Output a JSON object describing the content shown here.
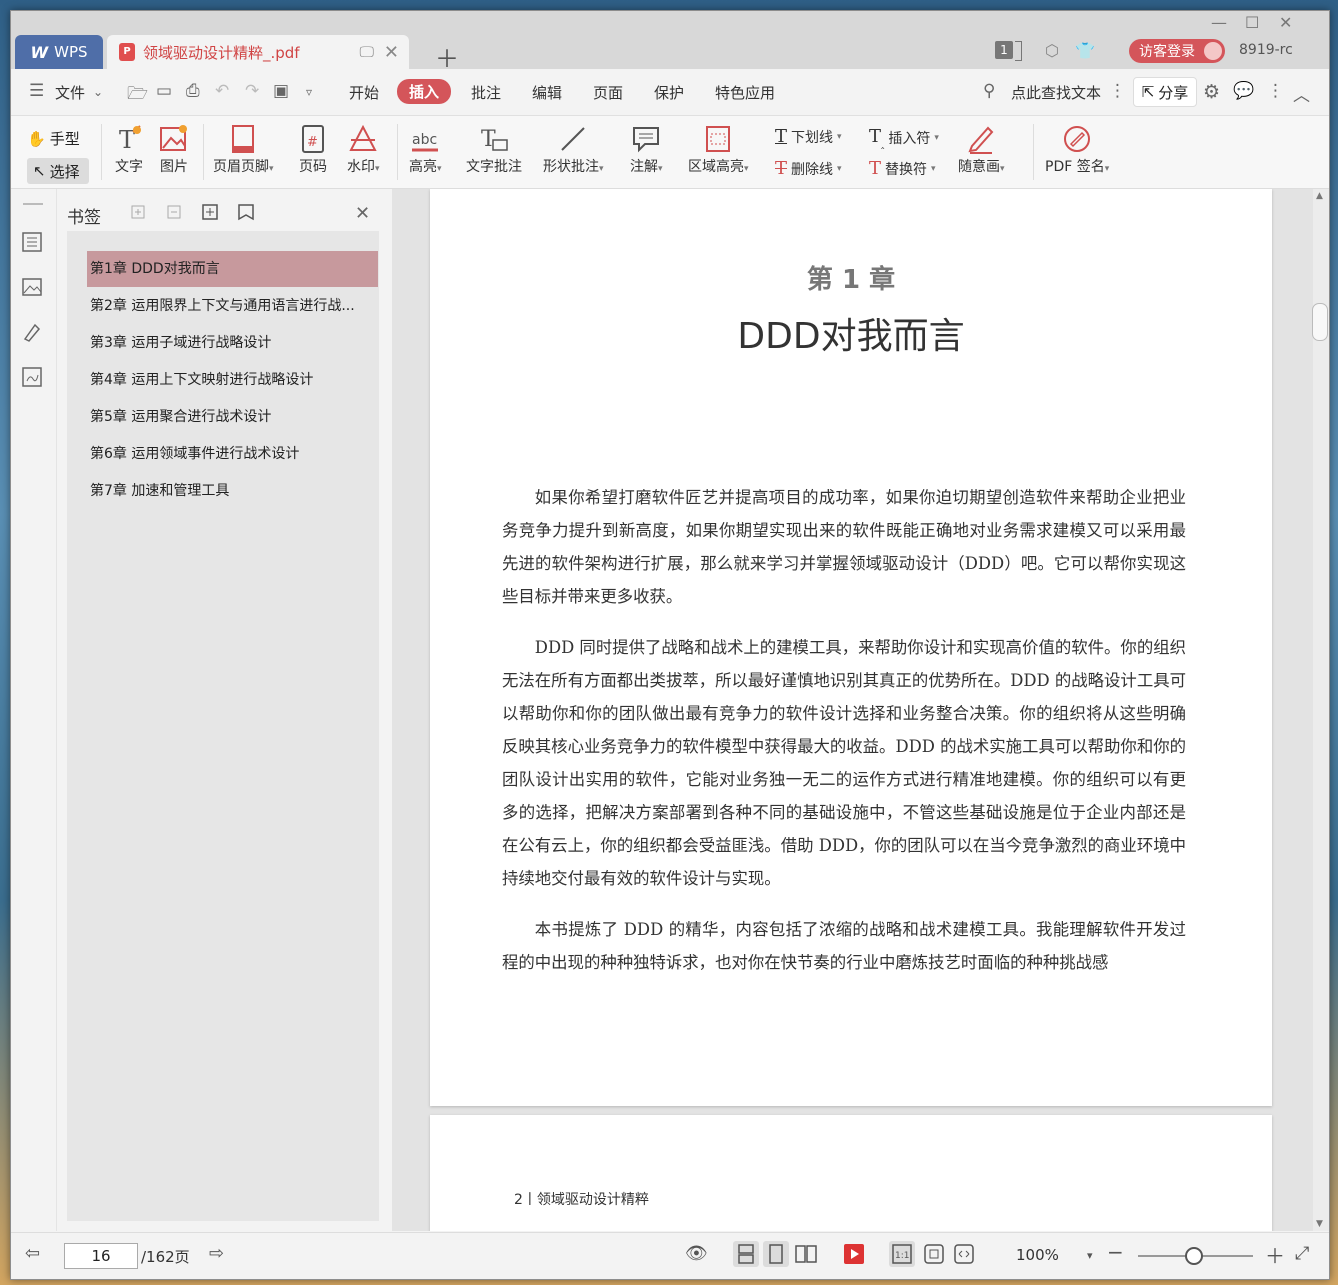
{
  "titlebar": {
    "app_tab": "WPS",
    "doc_tab": "领域驱动设计精粹_.pdf",
    "page_badge": "1",
    "login_label": "访客登录",
    "user_id": "8919-rc"
  },
  "menu": {
    "file_label": "文件",
    "tabs": [
      "开始",
      "插入",
      "批注",
      "编辑",
      "页面",
      "保护",
      "特色应用"
    ],
    "active_tab": "插入",
    "search_text": "点此查找文本",
    "share_label": "分享"
  },
  "ribbon": {
    "hand_label": "手型",
    "select_label": "选择",
    "text_label": "文字",
    "image_label": "图片",
    "header_footer_label": "页眉页脚",
    "page_num_label": "页码",
    "watermark_label": "水印",
    "highlight_label": "高亮",
    "text_note_label": "文字批注",
    "shape_note_label": "形状批注",
    "annotation_label": "注解",
    "area_highlight_label": "区域高亮",
    "underline_label": "下划线",
    "strikeout_label": "删除线",
    "insert_mark_label": "插入符",
    "replace_mark_label": "替换符",
    "freehand_label": "随意画",
    "pdf_sign_label": "PDF 签名"
  },
  "bookmarks": {
    "title": "书签",
    "items": [
      "第1章 DDD对我而言",
      "第2章 运用限界上下文与通用语言进行战...",
      "第3章 运用子域进行战略设计",
      "第4章 运用上下文映射进行战略设计",
      "第5章 运用聚合进行战术设计",
      "第6章 运用领域事件进行战术设计",
      "第7章 加速和管理工具"
    ],
    "selected_index": 0
  },
  "document": {
    "chapter_number": "第 1 章",
    "chapter_title": "DDD对我而言",
    "paragraphs": [
      "如果你希望打磨软件匠艺并提高项目的成功率，如果你迫切期望创造软件来帮助企业把业务竞争力提升到新高度，如果你期望实现出来的软件既能正确地对业务需求建模又可以采用最先进的软件架构进行扩展，那么就来学习并掌握领域驱动设计（DDD）吧。它可以帮你实现这些目标并带来更多收获。",
      "DDD 同时提供了战略和战术上的建模工具，来帮助你设计和实现高价值的软件。你的组织无法在所有方面都出类拔萃，所以最好谨慎地识别其真正的优势所在。DDD 的战略设计工具可以帮助你和你的团队做出最有竞争力的软件设计选择和业务整合决策。你的组织将从这些明确反映其核心业务竞争力的软件模型中获得最大的收益。DDD 的战术实施工具可以帮助你和你的团队设计出实用的软件，它能对业务独一无二的运作方式进行精准地建模。你的组织可以有更多的选择，把解决方案部署到各种不同的基础设施中，不管这些基础设施是位于企业内部还是在公有云上，你的组织都会受益匪浅。借助 DDD，你的团队可以在当今竞争激烈的商业环境中持续地交付最有效的软件设计与实现。",
      "本书提炼了 DDD 的精华，内容包括了浓缩的战略和战术建模工具。我能理解软件开发过程的中出现的种种独特诉求，也对你在快节奏的行业中磨炼技艺时面临的种种挑战感"
    ],
    "page2_header": "2丨领域驱动设计精粹"
  },
  "statusbar": {
    "current_page": "16",
    "total_pages": "/162页",
    "zoom": "100%"
  },
  "colors": {
    "accent": "#d4555a",
    "wps_tab": "#4f6ea8",
    "bookmark_selected": "#c7999d"
  }
}
